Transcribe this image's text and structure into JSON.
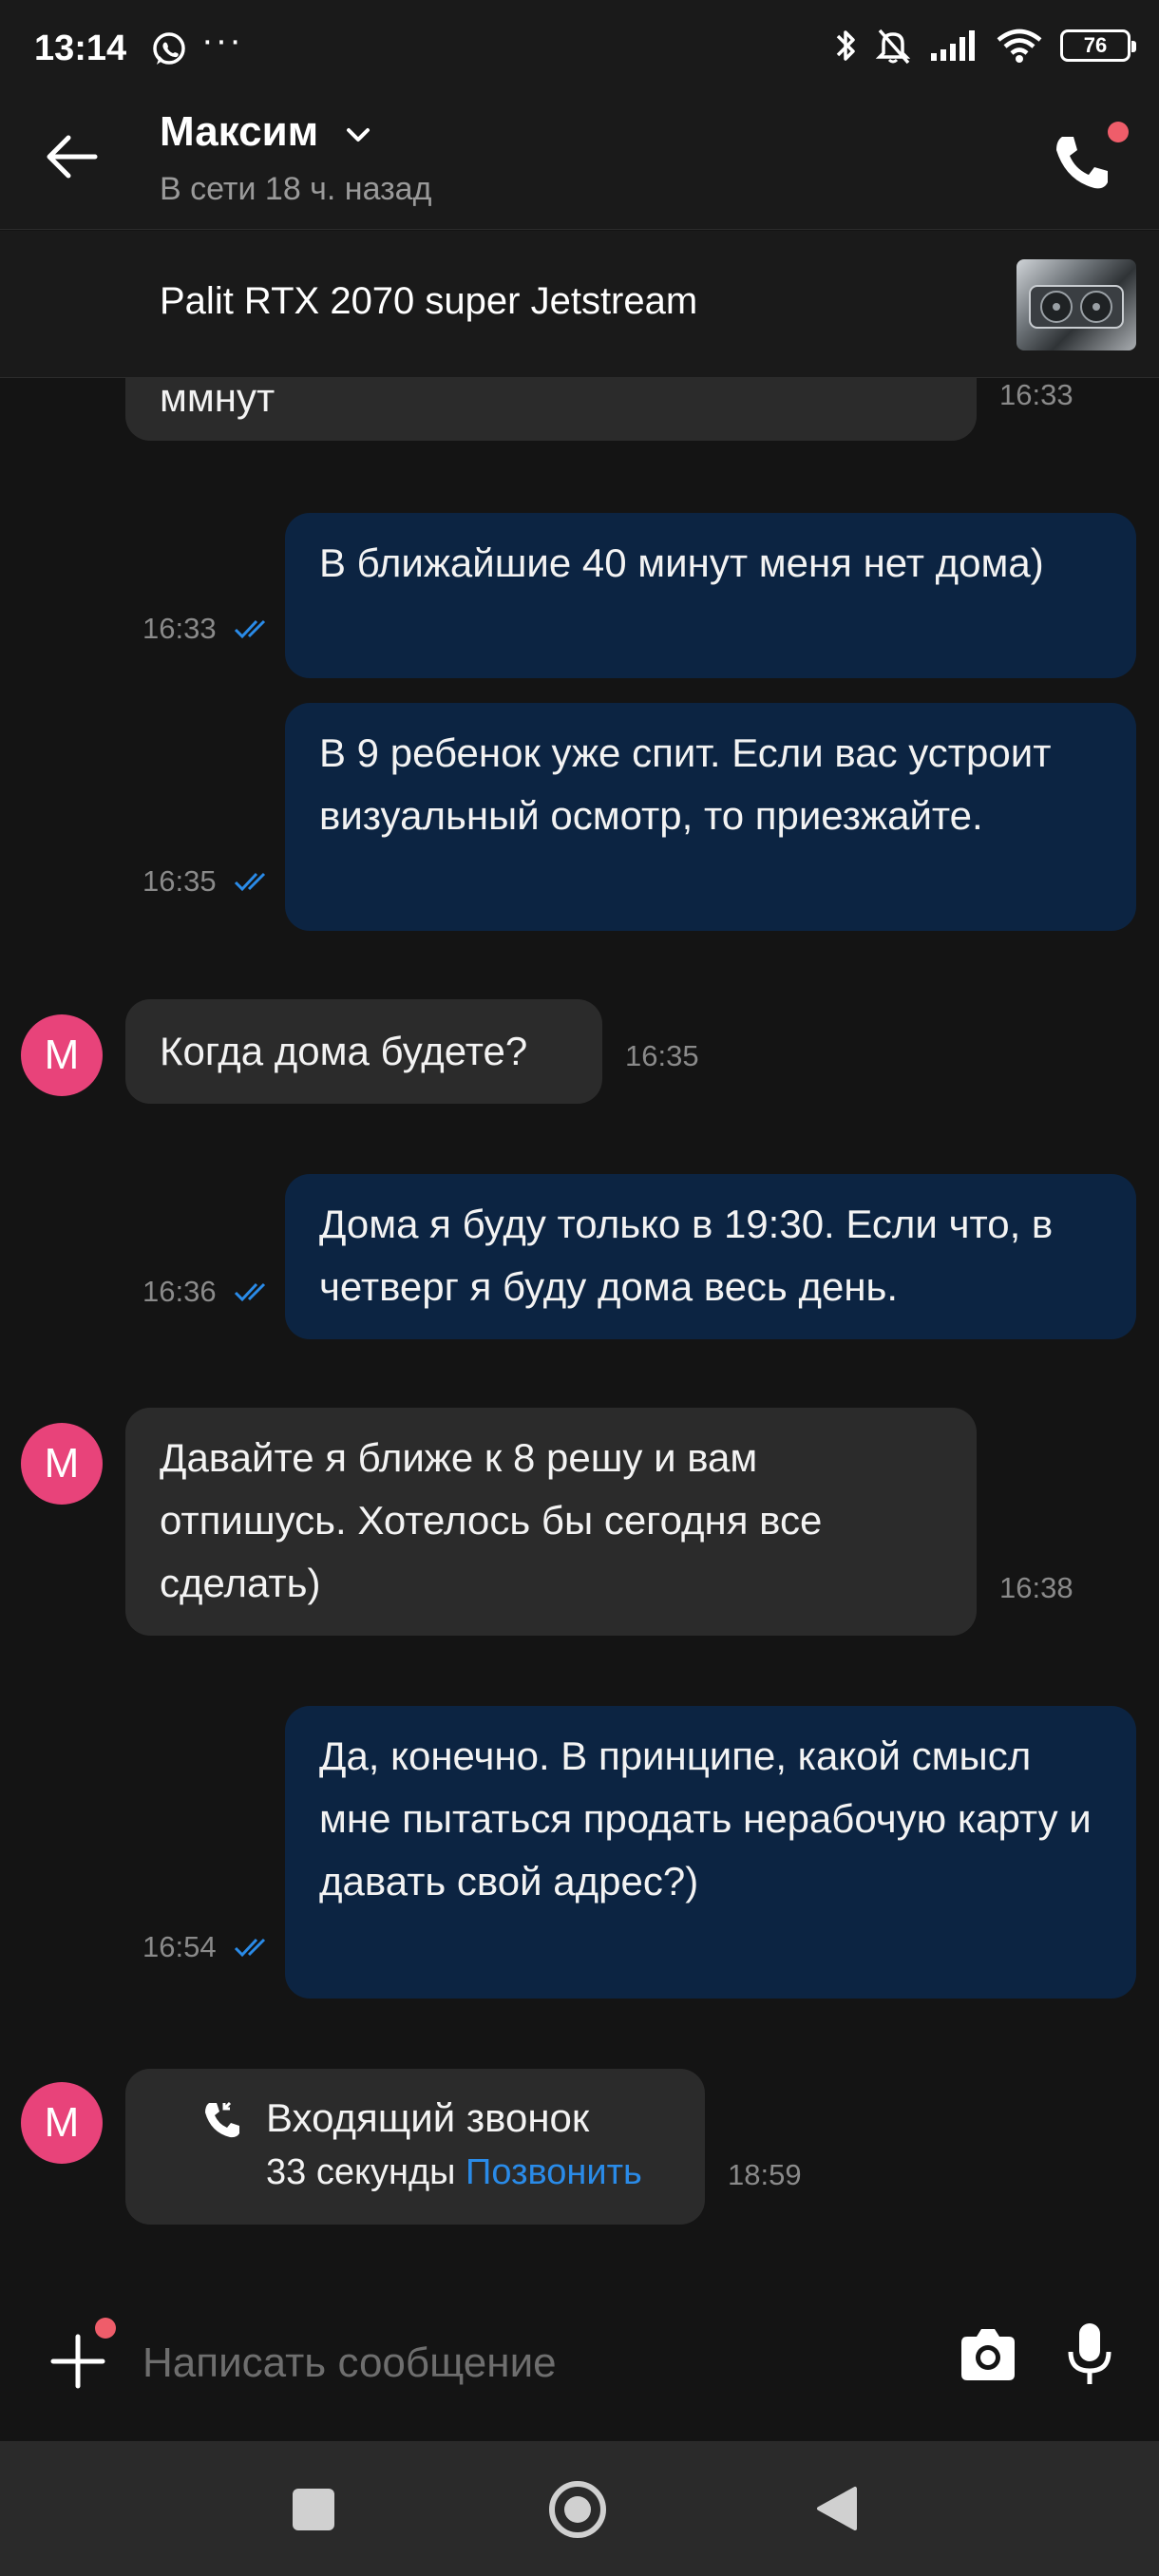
{
  "status_bar": {
    "time": "13:14",
    "dots": "···",
    "battery": "76"
  },
  "header": {
    "contact_name": "Максим",
    "status": "В сети 18 ч. назад"
  },
  "listing": {
    "title": "Palit RTX 2070 super Jetstream"
  },
  "messages": [
    {
      "side": "in",
      "text": "ммнут",
      "time": "16:33"
    },
    {
      "side": "out",
      "text": "В ближайшие 40 минут меня нет дома)",
      "time": "16:33",
      "read": true
    },
    {
      "side": "out",
      "text": "В 9 ребенок уже спит. Если вас устроит визуальный осмотр, то приезжайте.",
      "time": "16:35",
      "read": true
    },
    {
      "side": "in",
      "avatar": "M",
      "text": "Когда дома будете?",
      "time": "16:35"
    },
    {
      "side": "out",
      "text": "Дома я буду только в 19:30. Если что, в четверг я буду дома весь день.",
      "time": "16:36",
      "read": true
    },
    {
      "side": "in",
      "avatar": "M",
      "text": "Давайте я ближе к 8 решу и вам отпишусь.  Хотелось бы сегодня все сделать)",
      "time": "16:38"
    },
    {
      "side": "out",
      "text": "Да, конечно. В принципе, какой смысл мне пытаться продать нерабочую карту и давать свой адрес?)",
      "time": "16:54",
      "read": true
    }
  ],
  "call_message": {
    "avatar": "M",
    "title": "Входящий звонок",
    "duration": "33 секунды",
    "action": "Позвонить",
    "time": "18:59"
  },
  "input": {
    "placeholder": "Написать сообщение"
  },
  "colors": {
    "background": "#141414",
    "incoming_bubble": "#2b2b2b",
    "outgoing_bubble": "#0c2442",
    "avatar": "#e8437a",
    "link": "#2a8be8",
    "notification_dot": "#ef5d6a"
  }
}
